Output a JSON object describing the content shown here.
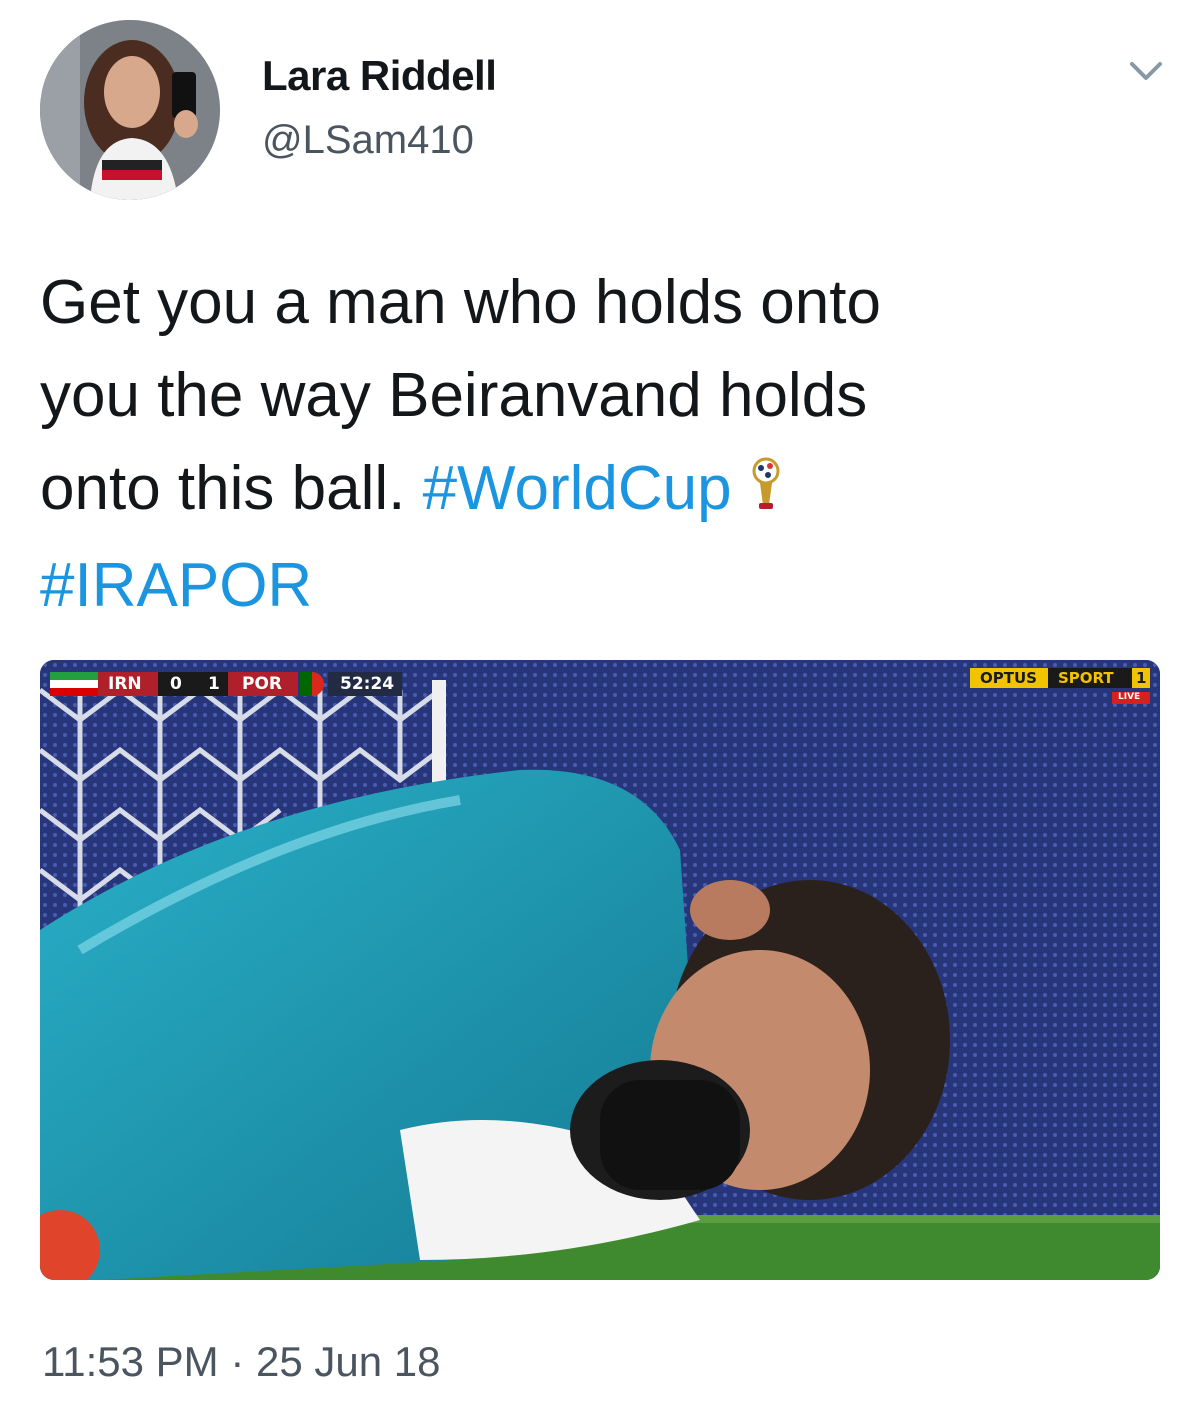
{
  "user": {
    "display_name": "Lara Riddell",
    "handle": "@LSam410"
  },
  "tweet": {
    "text_lines": [
      "Get you a man who holds onto",
      "you the way Beiranvand holds",
      "onto this ball."
    ],
    "hashtags": [
      "#WorldCup",
      "#IRAPOR"
    ],
    "emoji": "world-cup-trophy-icon",
    "timestamp": "11:53 PM",
    "separator": "·",
    "date": "25 Jun 18"
  },
  "media": {
    "scoreboard": {
      "home_team": "IRN",
      "home_score": "0",
      "away_score": "1",
      "away_team": "POR",
      "clock": "52:24"
    },
    "broadcaster": {
      "name_left": "OPTUS",
      "name_right": "SPORT",
      "channel": "1",
      "live_label": "LIVE"
    }
  },
  "colors": {
    "text": "#14171a",
    "secondary": "#4a5560",
    "hashtag": "#1b95e0",
    "jersey": "#1f9bb3",
    "pitch": "#3f8a2e",
    "board": "#2a3a84"
  }
}
